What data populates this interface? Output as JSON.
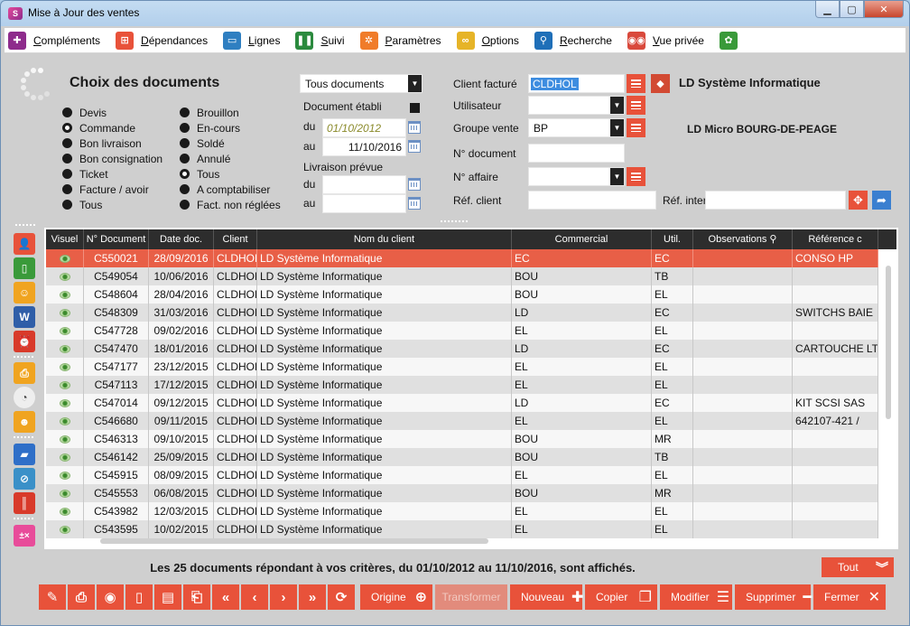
{
  "window": {
    "title": "Mise à Jour des ventes",
    "app_icon_text": "S"
  },
  "menu": [
    {
      "label": "Compléments",
      "icon": "puzzle-icon",
      "color": "#8e2c8c",
      "glyph": "✚"
    },
    {
      "label": "Dépendances",
      "icon": "hierarchy-icon",
      "color": "#e8523a",
      "glyph": "⊞"
    },
    {
      "label": "Lignes",
      "icon": "basket-icon",
      "color": "#2f7fc1",
      "glyph": "▭"
    },
    {
      "label": "Suivi",
      "icon": "footsteps-icon",
      "color": "#2b8a3e",
      "glyph": "❚❚"
    },
    {
      "label": "Paramètres",
      "icon": "gear-icon",
      "color": "#f07c2a",
      "glyph": "✲"
    },
    {
      "label": "Options",
      "icon": "glasses-icon",
      "color": "#e6b428",
      "glyph": "∞"
    },
    {
      "label": "Recherche",
      "icon": "magnifier-icon",
      "color": "#1f6fb8",
      "glyph": "⚲"
    },
    {
      "label": "Vue privée",
      "icon": "binoculars-icon",
      "color": "#d9493c",
      "glyph": "◉◉"
    },
    {
      "label": "",
      "icon": "colors-icon",
      "color": "#3a9a3a",
      "glyph": "✿"
    }
  ],
  "filters": {
    "title": "Choix des documents",
    "type_left": [
      {
        "label": "Devis",
        "selected": false
      },
      {
        "label": "Commande",
        "selected": true
      },
      {
        "label": "Bon livraison",
        "selected": false
      },
      {
        "label": "Bon consignation",
        "selected": false
      },
      {
        "label": "Ticket",
        "selected": false
      },
      {
        "label": "Facture / avoir",
        "selected": false
      },
      {
        "label": "Tous",
        "selected": false
      }
    ],
    "type_right": [
      {
        "label": "Brouillon",
        "selected": false
      },
      {
        "label": "En-cours",
        "selected": false
      },
      {
        "label": "Soldé",
        "selected": false
      },
      {
        "label": "Annulé",
        "selected": false
      },
      {
        "label": "Tous",
        "selected": true
      },
      {
        "label": "A comptabiliser",
        "selected": false
      },
      {
        "label": "Fact. non réglées",
        "selected": false
      }
    ],
    "documents_select": "Tous documents",
    "document_etabli_label": "Document établi",
    "du_label": "du",
    "au_label": "au",
    "date_from": "01/10/2012",
    "date_to": "11/10/2016",
    "livraison_label": "Livraison prévue",
    "livraison_du": "",
    "livraison_au": "",
    "client_label": "Client facturé",
    "client_value": "CLDHOL",
    "client_name": "LD Système Informatique",
    "utilisateur_label": "Utilisateur",
    "utilisateur_value": "",
    "groupe_label": "Groupe vente",
    "groupe_value": "BP",
    "groupe_name": "LD Micro BOURG-DE-PEAGE",
    "n_document_label": "N° document",
    "n_document_value": "",
    "n_affaire_label": "N° affaire",
    "n_affaire_value": "",
    "ref_client_label": "Réf. client",
    "ref_client_value": "",
    "ref_interne_label": "Réf. interne",
    "ref_interne_value": ""
  },
  "table": {
    "columns": [
      "Visuel",
      "N° Document",
      "Date doc.",
      "Client",
      "Nom du client",
      "Commercial",
      "Util.",
      "Observations",
      "Référence c"
    ],
    "rows": [
      {
        "doc": "C550021",
        "date": "28/09/2016",
        "client": "CLDHOL",
        "nom": "LD Système Informatique",
        "com": "EC",
        "util": "EC",
        "obs": "",
        "ref": "CONSO HP"
      },
      {
        "doc": "C549054",
        "date": "10/06/2016",
        "client": "CLDHOL",
        "nom": "LD Système Informatique",
        "com": "BOU",
        "util": "TB",
        "obs": "",
        "ref": ""
      },
      {
        "doc": "C548604",
        "date": "28/04/2016",
        "client": "CLDHOL",
        "nom": "LD Système Informatique",
        "com": "BOU",
        "util": "EL",
        "obs": "",
        "ref": ""
      },
      {
        "doc": "C548309",
        "date": "31/03/2016",
        "client": "CLDHOL",
        "nom": "LD Système Informatique",
        "com": "LD",
        "util": "EC",
        "obs": "",
        "ref": "SWITCHS BAIE"
      },
      {
        "doc": "C547728",
        "date": "09/02/2016",
        "client": "CLDHOL",
        "nom": "LD Système Informatique",
        "com": "EL",
        "util": "EL",
        "obs": "",
        "ref": ""
      },
      {
        "doc": "C547470",
        "date": "18/01/2016",
        "client": "CLDHOL",
        "nom": "LD Système Informatique",
        "com": "LD",
        "util": "EC",
        "obs": "",
        "ref": "CARTOUCHE LT"
      },
      {
        "doc": "C547177",
        "date": "23/12/2015",
        "client": "CLDHOL",
        "nom": "LD Système Informatique",
        "com": "EL",
        "util": "EL",
        "obs": "",
        "ref": ""
      },
      {
        "doc": "C547113",
        "date": "17/12/2015",
        "client": "CLDHOL",
        "nom": "LD Système Informatique",
        "com": "EL",
        "util": "EL",
        "obs": "",
        "ref": ""
      },
      {
        "doc": "C547014",
        "date": "09/12/2015",
        "client": "CLDHOL",
        "nom": "LD Système Informatique",
        "com": "LD",
        "util": "EC",
        "obs": "",
        "ref": "KIT SCSI SAS"
      },
      {
        "doc": "C546680",
        "date": "09/11/2015",
        "client": "CLDHOL",
        "nom": "LD Système Informatique",
        "com": "EL",
        "util": "EL",
        "obs": "",
        "ref": "642107-421 /"
      },
      {
        "doc": "C546313",
        "date": "09/10/2015",
        "client": "CLDHOL",
        "nom": "LD Système Informatique",
        "com": "BOU",
        "util": "MR",
        "obs": "",
        "ref": ""
      },
      {
        "doc": "C546142",
        "date": "25/09/2015",
        "client": "CLDHOL",
        "nom": "LD Système Informatique",
        "com": "BOU",
        "util": "TB",
        "obs": "",
        "ref": ""
      },
      {
        "doc": "C545915",
        "date": "08/09/2015",
        "client": "CLDHOL",
        "nom": "LD Système Informatique",
        "com": "EL",
        "util": "EL",
        "obs": "",
        "ref": ""
      },
      {
        "doc": "C545553",
        "date": "06/08/2015",
        "client": "CLDHOL",
        "nom": "LD Système Informatique",
        "com": "BOU",
        "util": "MR",
        "obs": "",
        "ref": ""
      },
      {
        "doc": "C543982",
        "date": "12/03/2015",
        "client": "CLDHOL",
        "nom": "LD Système Informatique",
        "com": "EL",
        "util": "EL",
        "obs": "",
        "ref": ""
      },
      {
        "doc": "C543595",
        "date": "10/02/2015",
        "client": "CLDHOL",
        "nom": "LD Système Informatique",
        "com": "EL",
        "util": "EL",
        "obs": "",
        "ref": ""
      }
    ]
  },
  "status": "Les 25 documents répondant à vos critères, du 01/10/2012 au 11/10/2016, sont affichés.",
  "buttons": {
    "tout": "Tout",
    "origine": "Origine",
    "transformer": "Transformer",
    "nouveau": "Nouveau",
    "copier": "Copier",
    "modifier": "Modifier",
    "supprimer": "Supprimer",
    "fermer": "Fermer"
  },
  "colors": {
    "accent": "#e8523a",
    "selected_row": "#e85f47",
    "header": "#2d2d2d"
  }
}
